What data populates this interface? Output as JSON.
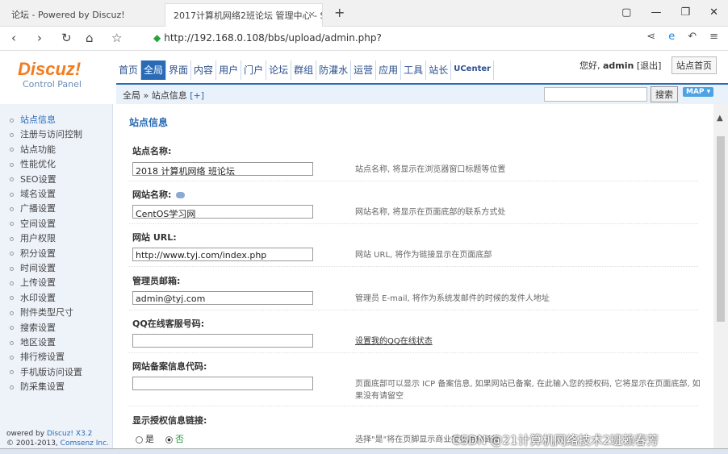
{
  "browser": {
    "tab1": "论坛 - Powered by Discuz!",
    "tab2": "2017计算机网络2班论坛 管理中心 - S",
    "url": "http://192.168.0.108/bbs/upload/admin.php?"
  },
  "header": {
    "logo": "Discuz!",
    "subtitle": "Control Panel",
    "nav": [
      "首页",
      "全局",
      "界面",
      "内容",
      "用户",
      "门户",
      "论坛",
      "群组",
      "防灌水",
      "运营",
      "应用",
      "工具",
      "站长",
      "UCenter"
    ],
    "greeting": "您好,",
    "username": "admin",
    "logout": "[退出]",
    "site_home": "站点首页"
  },
  "crumbbar": {
    "path": "全局 » 站点信息",
    "plus": "[+]",
    "search_btn": "搜索",
    "map_btn": "MAP ▾"
  },
  "sidebar": {
    "items": [
      "站点信息",
      "注册与访问控制",
      "站点功能",
      "性能优化",
      "SEO设置",
      "域名设置",
      "广播设置",
      "空间设置",
      "用户权限",
      "积分设置",
      "时间设置",
      "上传设置",
      "水印设置",
      "附件类型尺寸",
      "搜索设置",
      "地区设置",
      "排行榜设置",
      "手机版访问设置",
      "防采集设置"
    ],
    "footer_line1": "owered by",
    "footer_brand": "Discuz! X3.2",
    "footer_line2": "© 2001-2013,",
    "footer_company": "Comsenz Inc."
  },
  "content": {
    "section_title": "站点信息",
    "fields": [
      {
        "label": "站点名称:",
        "value": "2018 计算机网络  班论坛",
        "desc": "站点名称, 将显示在浏览器窗口标题等位置"
      },
      {
        "label": "网站名称:",
        "value": "CentOS学习网",
        "desc": "网站名称, 将显示在页面底部的联系方式处"
      },
      {
        "label": "网站 URL:",
        "value": "http://www.tyj.com/index.php",
        "desc": "网站 URL, 将作为链接显示在页面底部"
      },
      {
        "label": "管理员邮箱:",
        "value": "admin@tyj.com",
        "desc": "管理员 E-mail, 将作为系统发邮件的时候的发件人地址"
      },
      {
        "label": "QQ在线客服号码:",
        "value": "",
        "desc": "设置我的QQ在线状态"
      },
      {
        "label": "网站备案信息代码:",
        "value": "",
        "desc": "页面底部可以显示 ICP 备案信息, 如果网站已备案, 在此输入您的授权码, 它将显示在页面底部, 如果没有请留空"
      }
    ],
    "auth_label": "显示授权信息链接:",
    "radio_yes": "是",
    "radio_no": "否",
    "auth_desc": "选择\"是\"将在页脚显示商业授权用户链接"
  },
  "watermark": "CSDN @21计算机网络技术2班赖春芳"
}
